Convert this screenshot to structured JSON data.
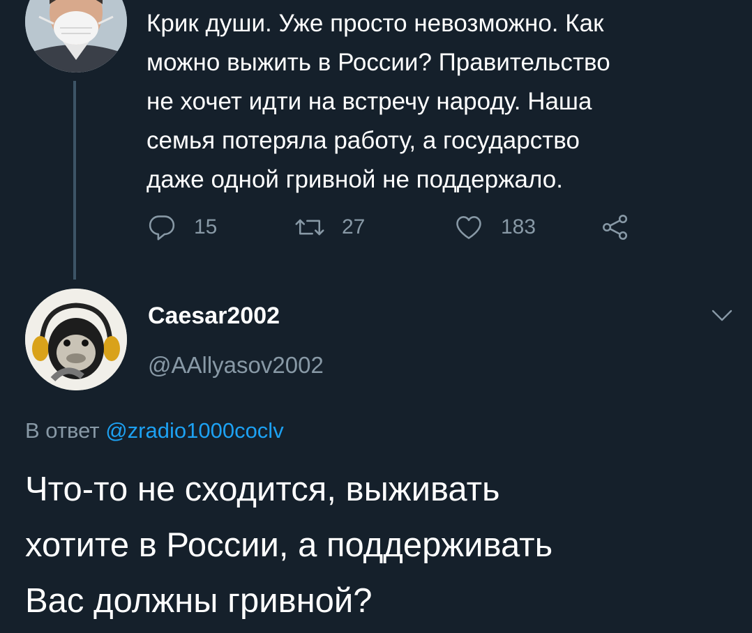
{
  "parent_tweet": {
    "avatar_icon": "man-in-face-mask-avatar",
    "text": "Крик души. Уже просто невозможно. Как\nможно выжить в России? Правительство\nне хочет идти на встречу народу. Наша\nсемья потеряла работу, а государство\nдаже одной гривной не поддержало.",
    "actions": {
      "reply_count": "15",
      "retweet_count": "27",
      "like_count": "183",
      "share_icon": "share-icon"
    }
  },
  "reply_tweet": {
    "avatar_icon": "monkey-with-headphones-avatar",
    "display_name": "Caesar2002",
    "handle": "@AAllyasov2002",
    "reply_to_prefix": "В ответ",
    "reply_to_mention": "@zradio1000coclv",
    "text": "Что-то не сходится, выживать\nхотите в России, а поддерживать\nВас должны гривной?"
  },
  "colors": {
    "background": "#15202b",
    "text": "#ffffff",
    "secondary": "#8899a6",
    "link": "#1da1f2",
    "thread_line": "#3d5466"
  }
}
